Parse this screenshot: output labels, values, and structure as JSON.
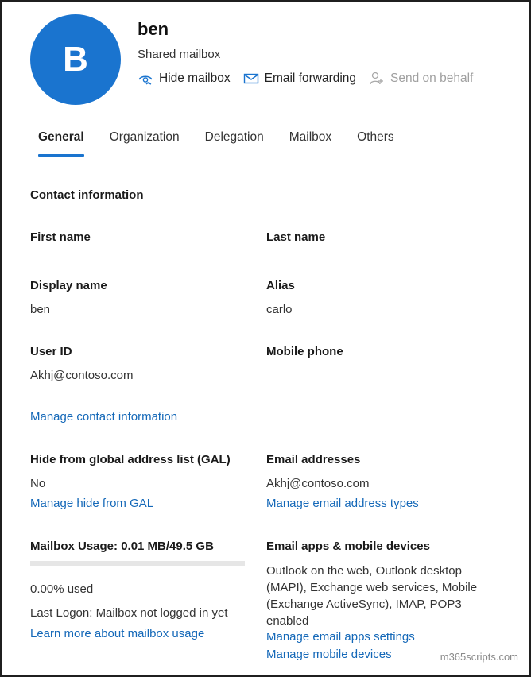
{
  "header": {
    "avatar_initial": "B",
    "name": "ben",
    "subtitle": "Shared mailbox",
    "actions": [
      {
        "label": "Hide mailbox",
        "icon": "eye-hide-icon",
        "enabled": true
      },
      {
        "label": "Email forwarding",
        "icon": "envelope-forward-icon",
        "enabled": true
      },
      {
        "label": "Send on behalf",
        "icon": "person-icon",
        "enabled": false
      }
    ]
  },
  "tabs": [
    {
      "label": "General",
      "active": true
    },
    {
      "label": "Organization",
      "active": false
    },
    {
      "label": "Delegation",
      "active": false
    },
    {
      "label": "Mailbox",
      "active": false
    },
    {
      "label": "Others",
      "active": false
    }
  ],
  "contact": {
    "section_title": "Contact information",
    "first_name_label": "First name",
    "last_name_label": "Last name",
    "display_name_label": "Display name",
    "display_name_value": "ben",
    "alias_label": "Alias",
    "alias_value": "carlo",
    "user_id_label": "User ID",
    "user_id_value": "Akhj@contoso.com",
    "mobile_phone_label": "Mobile phone",
    "manage_link": "Manage contact information"
  },
  "gal": {
    "label": "Hide from global address list (GAL)",
    "value": "No",
    "link": "Manage hide from GAL"
  },
  "email_addresses": {
    "label": "Email addresses",
    "value": "Akhj@contoso.com",
    "link": "Manage email address types"
  },
  "mailbox_usage": {
    "label": "Mailbox Usage: 0.01 MB/49.5 GB",
    "used_fraction": 0.0,
    "used_text": "0.00% used",
    "last_logon": "Last Logon: Mailbox not logged in yet",
    "link": "Learn more about mailbox usage"
  },
  "email_apps": {
    "label": "Email apps & mobile devices",
    "description": "Outlook on the web, Outlook desktop (MAPI), Exchange web services, Mobile (Exchange ActiveSync), IMAP, POP3 enabled",
    "link_apps": "Manage email apps settings",
    "link_devices": "Manage mobile devices"
  },
  "watermark": "m365scripts.com",
  "colors": {
    "accent": "#1a74cf",
    "link": "#1468b8",
    "disabled": "#a0a0a0"
  }
}
